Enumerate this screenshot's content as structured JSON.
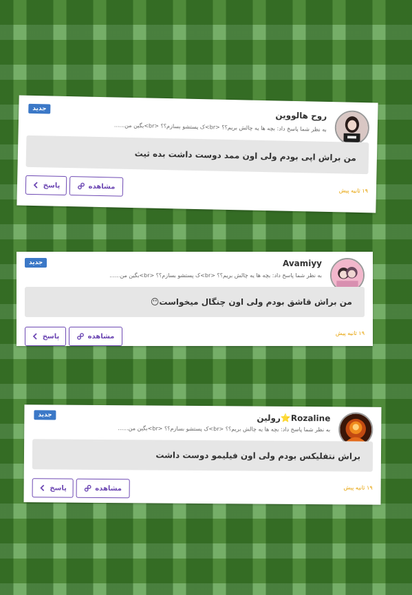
{
  "ui": {
    "new_badge": "جدید",
    "view_label": "مشاهده",
    "reply_label": "پاسخ"
  },
  "notifications": [
    {
      "username": "روح هالووین",
      "subline": "به نظر شما پاسخ داد: بچه ها یه چالش بریم؟؟ <br>ک پستشو بسازم؟؟ <br>بگین من......",
      "comment": "من براش اپی بودم ولی اون ممد دوست داشت بده ثیث",
      "time": "۱۹ ثانیه پیش"
    },
    {
      "username": "Avamiyy",
      "subline": "به نظر شما پاسخ داد: بچه ها یه چالش بریم؟؟ <br>ک پستشو بسازم؟؟ <br>بگین من......",
      "comment": "من براش قاشق بودم ولی اون چنگال میخواست😶",
      "time": "۱۹ ثانیه پیش"
    },
    {
      "username": "Rozaline⭐رولین",
      "subline": "به نظر شما پاسخ داد: بچه ها یه چالش بریم؟؟ <br>ک پستشو بسازم؟؟ <br>بگین من......",
      "comment": "براش نتفلیکس بودم ولی اون فیلیمو دوست داشت",
      "time": "۱۹ ثانیه پیش"
    }
  ],
  "colors": {
    "badge": "#3b78c7",
    "button_border": "#6d48b3",
    "time": "#e6a000"
  },
  "icons": [
    "link-icon",
    "chevron-left-icon"
  ]
}
